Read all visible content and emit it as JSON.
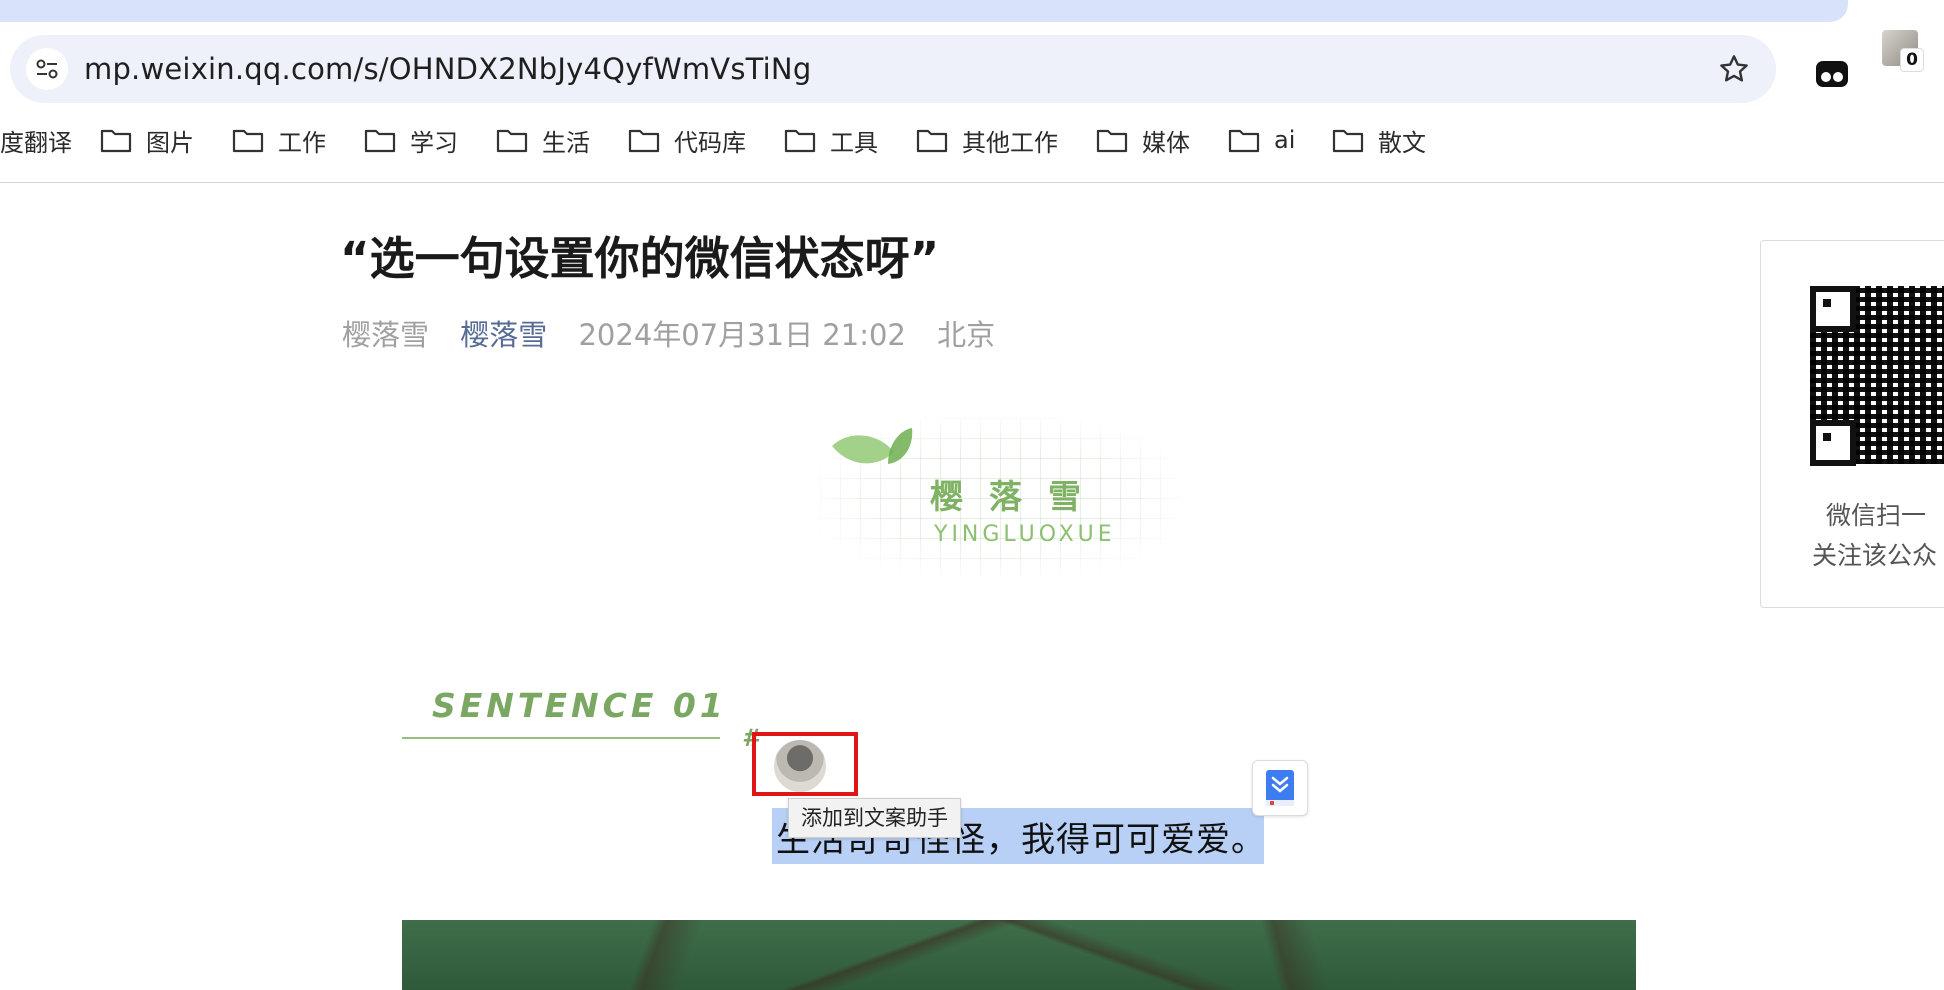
{
  "browser": {
    "url": "mp.weixin.qq.com/s/OHNDX2NbJy4QyfWmVsTiNg",
    "profile_badge": "0",
    "bookmarks": [
      "度翻译",
      "图片",
      "工作",
      "学习",
      "生活",
      "代码库",
      "工具",
      "其他工作",
      "媒体",
      "ai",
      "散文"
    ]
  },
  "article": {
    "title": "“选一句设置你的微信状态呀”",
    "meta": {
      "author": "樱落雪",
      "account": "樱落雪",
      "datetime": "2024年07月31日 21:02",
      "location": "北京"
    },
    "logo": {
      "cn": "樱落雪",
      "en": "YINGLUOXUE"
    },
    "section_label": "SENTENCE 01",
    "hash": "#",
    "selected_text": "生活奇奇怪怪，我得可可爱爱。",
    "tooltip": "添加到文案助手"
  },
  "qr_panel": {
    "line1": "微信扫一",
    "line2": "关注该公众"
  },
  "colors": {
    "accent_green": "#7aa863",
    "link_blue": "#576b95",
    "selection": "#b8d0f5",
    "highlight_box": "#e01515"
  }
}
